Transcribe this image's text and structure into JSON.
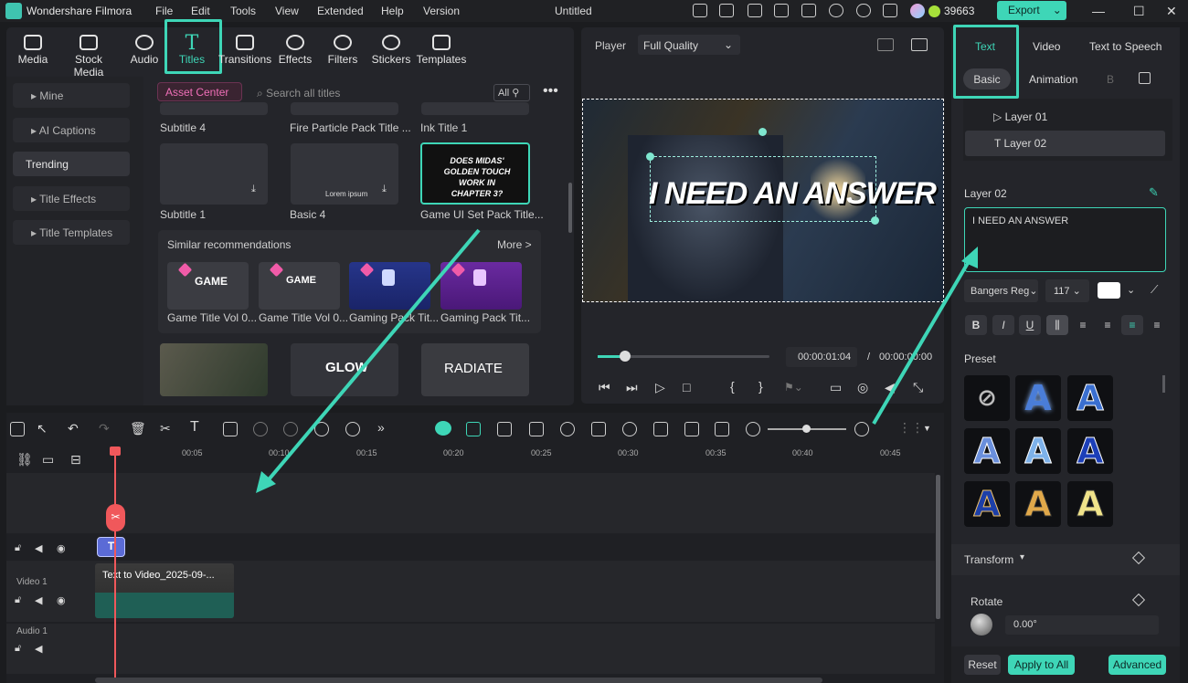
{
  "app": {
    "title": "Wondershare Filmora",
    "doc_title": "Untitled",
    "credits": "39663",
    "export_label": "Export"
  },
  "menu": [
    "File",
    "Edit",
    "Tools",
    "View",
    "Extended",
    "Help",
    "Version"
  ],
  "toolbar": [
    "Media",
    "Stock Media",
    "Audio",
    "Titles",
    "Transitions",
    "Effects",
    "Filters",
    "Stickers",
    "Templates"
  ],
  "sidebar": [
    "Mine",
    "AI Captions",
    "Trending",
    "Title Effects",
    "Title Templates"
  ],
  "library": {
    "asset_center": "Asset Center",
    "search_placeholder": "Search all titles",
    "filter_label": "All",
    "row0": [
      "Subtitle 4",
      "Fire Particle Pack Title ...",
      "Ink Title 1"
    ],
    "row1": [
      "Subtitle 1",
      "Basic 4",
      "Game UI Set Pack Title..."
    ],
    "basic4_preview": "Lorem ipsum",
    "gameui_preview": "DOES MIDAS' GOLDEN TOUCH WORK IN CHAPTER 3?",
    "similar_title": "Similar recommendations",
    "more": "More >",
    "similar_items": [
      "Game Title Vol 0...",
      "Game Title Vol 0...",
      "Gaming Pack Tit...",
      "Gaming Pack Tit..."
    ],
    "row3_previews": [
      "GLOW",
      "RADIATE"
    ]
  },
  "player": {
    "label": "Player",
    "quality": "Full Quality",
    "video_text": "I NEED AN ANSWER",
    "time_current": "00:00:01:04",
    "time_sep": "/",
    "time_total": "00:00:00:00",
    "progress": 0.16
  },
  "right": {
    "tabs": [
      "Text",
      "Video",
      "Text to Speech"
    ],
    "subtabs": [
      "Basic",
      "Animation",
      "B"
    ],
    "layers": [
      "Layer 01",
      "Layer 02"
    ],
    "layer_label": "Layer 02",
    "text_value": "I NEED AN ANSWER",
    "font": "Bangers Reg",
    "size": "117",
    "preset_label": "Preset",
    "transform_label": "Transform",
    "rotate_label": "Rotate",
    "rotate_value": "0.00°",
    "reset": "Reset",
    "apply_all": "Apply to All",
    "advanced": "Advanced",
    "format_buttons": [
      "B",
      "I",
      "U"
    ]
  },
  "timeline": {
    "ticks": [
      "00:05",
      "00:10",
      "00:15",
      "00:20",
      "00:25",
      "00:30",
      "00:35",
      "00:40",
      "00:45"
    ],
    "tracks": [
      "Video 1",
      "Audio 1"
    ],
    "clip_label": "Text to Video_2025-09-..."
  },
  "colors": {
    "accent": "#3ed6b7",
    "pink": "#f05ba8",
    "playhead": "#f0585b"
  }
}
